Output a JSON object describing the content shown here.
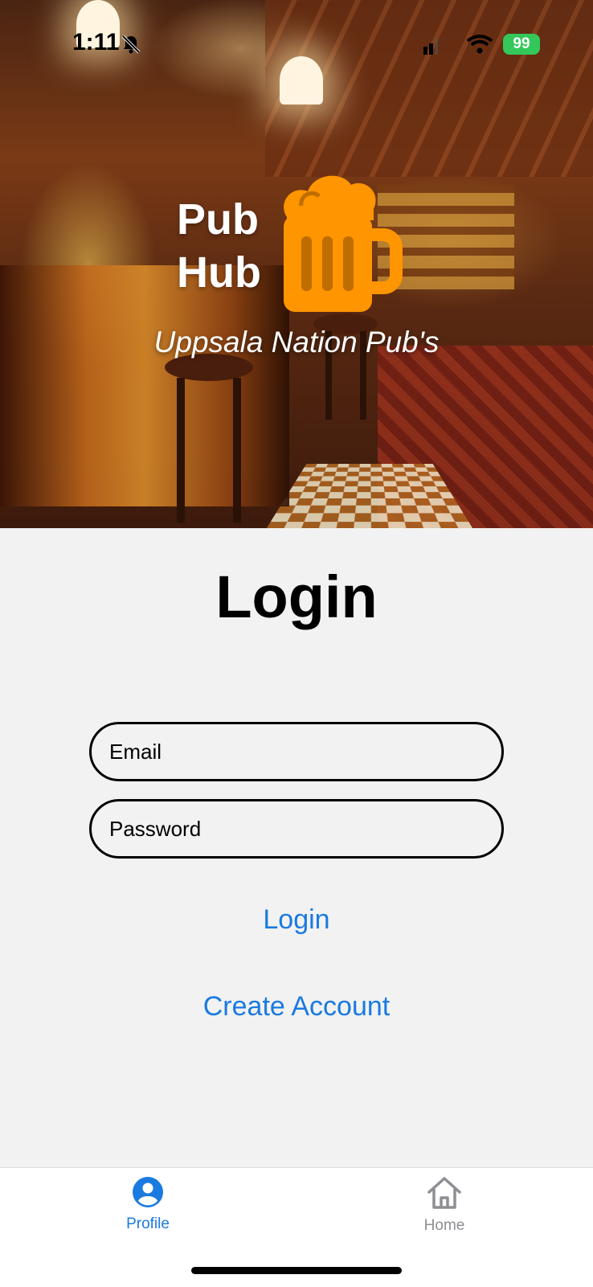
{
  "status_bar": {
    "time": "1:11",
    "battery": "99"
  },
  "hero": {
    "logo_line1": "Pub",
    "logo_line2": "Hub",
    "tagline": "Uppsala Nation Pub's"
  },
  "login": {
    "title": "Login",
    "email_placeholder": "Email",
    "password_placeholder": "Password",
    "login_button": "Login",
    "create_account_button": "Create Account"
  },
  "tabbar": {
    "items": [
      {
        "label": "Profile",
        "icon": "profile-icon",
        "active": true
      },
      {
        "label": "Home",
        "icon": "home-icon",
        "active": false
      }
    ]
  },
  "colors": {
    "accent": "#1a7ae0",
    "logo_orange": "#ff9500",
    "battery_green": "#34c759",
    "inactive_tab": "#8e8e93",
    "background": "#f2f2f2"
  }
}
